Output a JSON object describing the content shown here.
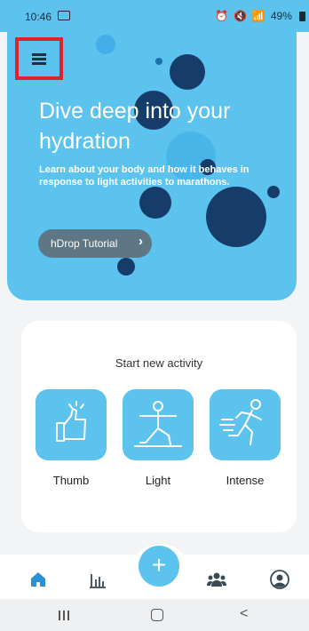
{
  "status_bar": {
    "time": "10:46",
    "battery": "49%"
  },
  "hero": {
    "headline": "Dive deep into your hydration",
    "subtext": "Learn about your body and how it behaves in response to light activities to marathons.",
    "tutorial_button": "hDrop Tutorial",
    "tutorial_chevron": "›"
  },
  "activity_card": {
    "title": "Start new activity",
    "activities": [
      {
        "label": "Thumb",
        "icon": "thumbs-up-icon"
      },
      {
        "label": "Light",
        "icon": "yoga-icon"
      },
      {
        "label": "Intense",
        "icon": "running-icon"
      }
    ]
  },
  "bottom_nav": {
    "fab_label": "+",
    "items": [
      "home-icon",
      "bar-chart-icon",
      "group-icon",
      "profile-icon"
    ]
  },
  "system_nav": {
    "back_glyph": "<"
  },
  "colors": {
    "accent": "#5cc3ef",
    "bubble_dark": "#163d69",
    "highlight": "#e0232b"
  }
}
